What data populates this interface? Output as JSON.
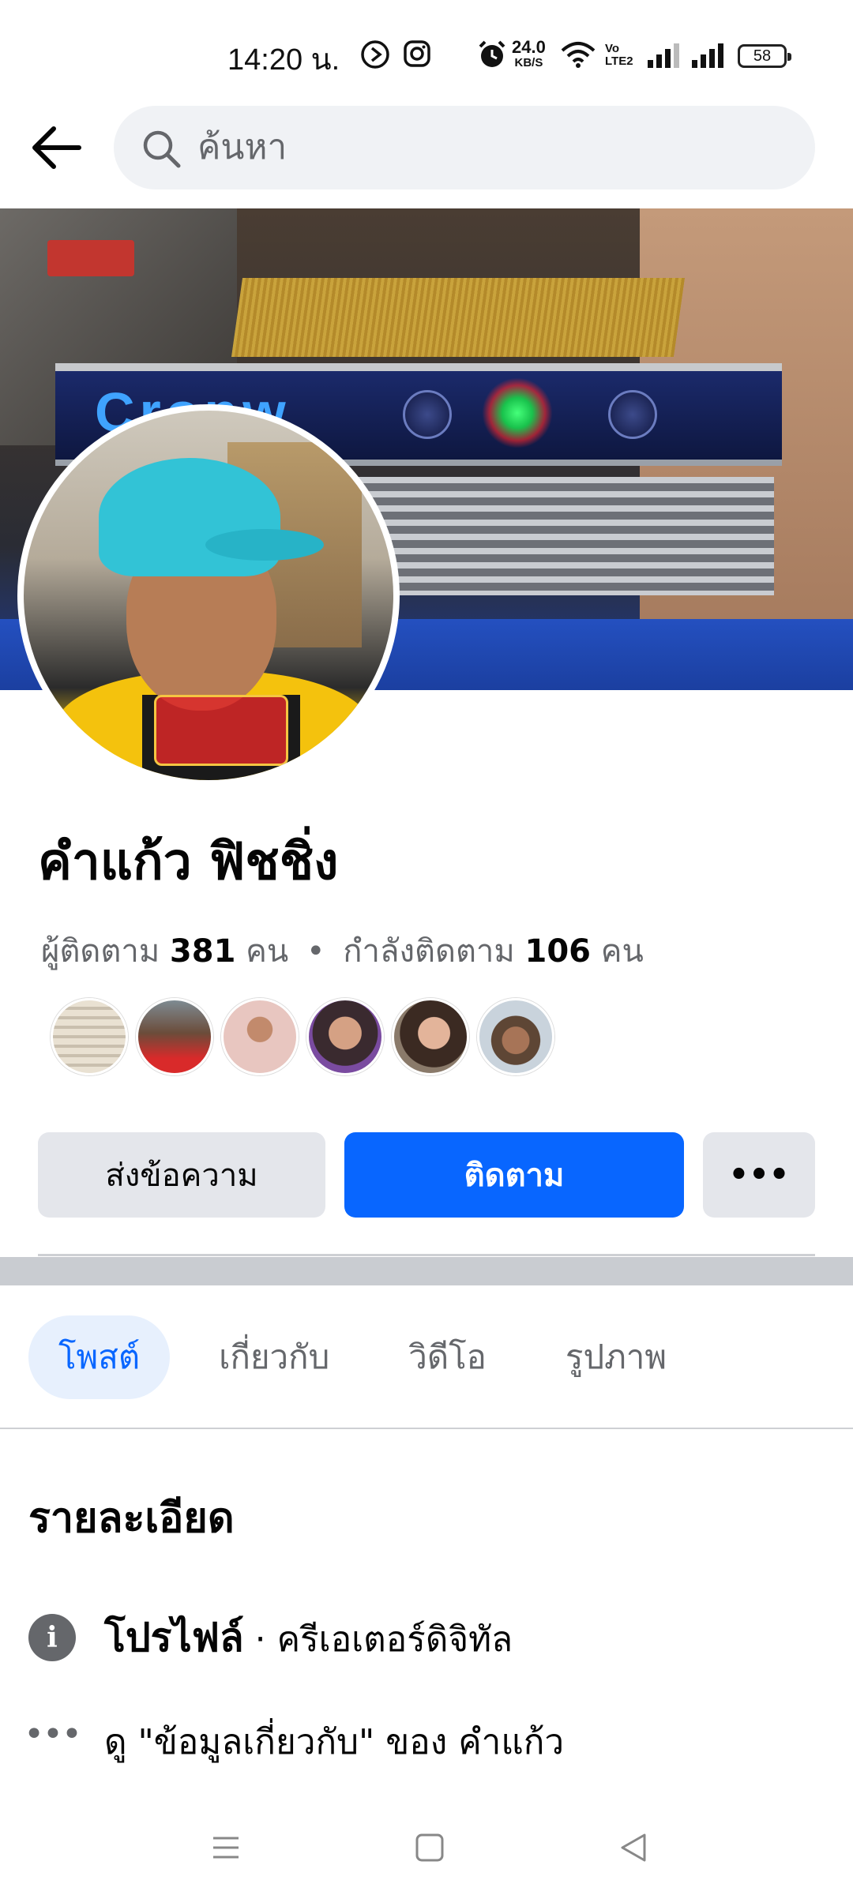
{
  "status_bar": {
    "time": "14:20 น.",
    "net_speed_value": "24.0",
    "net_speed_unit": "KB/S",
    "volte_line1": "Vo",
    "volte_line2": "LTE2",
    "battery": "58",
    "icons": [
      "screen-record-icon",
      "instagram-icon",
      "alarm-icon",
      "wifi-icon",
      "signal-icon",
      "signal-icon"
    ]
  },
  "header": {
    "search_placeholder": "ค้นหา",
    "icons": [
      "back-arrow-icon",
      "search-icon"
    ]
  },
  "cover": {
    "brand_text": "Cronw"
  },
  "profile": {
    "name": "คำแก้ว ฟิชชิ่ง",
    "followers_label": "ผู้ติดตาม",
    "followers_count": "381",
    "followers_unit": "คน",
    "separator": "•",
    "following_label": "กำลังติดตาม",
    "following_count": "106",
    "following_unit": "คน",
    "friend_avatars": 6
  },
  "actions": {
    "message_label": "ส่งข้อความ",
    "follow_label": "ติดตาม",
    "more_label": "•••"
  },
  "tabs": [
    {
      "label": "โพสต์",
      "active": true
    },
    {
      "label": "เกี่ยวกับ",
      "active": false
    },
    {
      "label": "วิดีโอ",
      "active": false
    },
    {
      "label": "รูปภาพ",
      "active": false
    }
  ],
  "details": {
    "title": "รายละเอียด",
    "profile_label": "โปรไฟล์",
    "profile_sep": " · ",
    "profile_category": "ครีเอเตอร์ดิจิทัล",
    "see_about_text": "ดู \"ข้อมูลเกี่ยวกับ\" ของ คำแก้ว"
  },
  "colors": {
    "accent": "#0866ff",
    "active_tab_bg": "#e7f0fd",
    "secondary_button": "#e4e6eb",
    "secondary_text": "#65676b"
  }
}
